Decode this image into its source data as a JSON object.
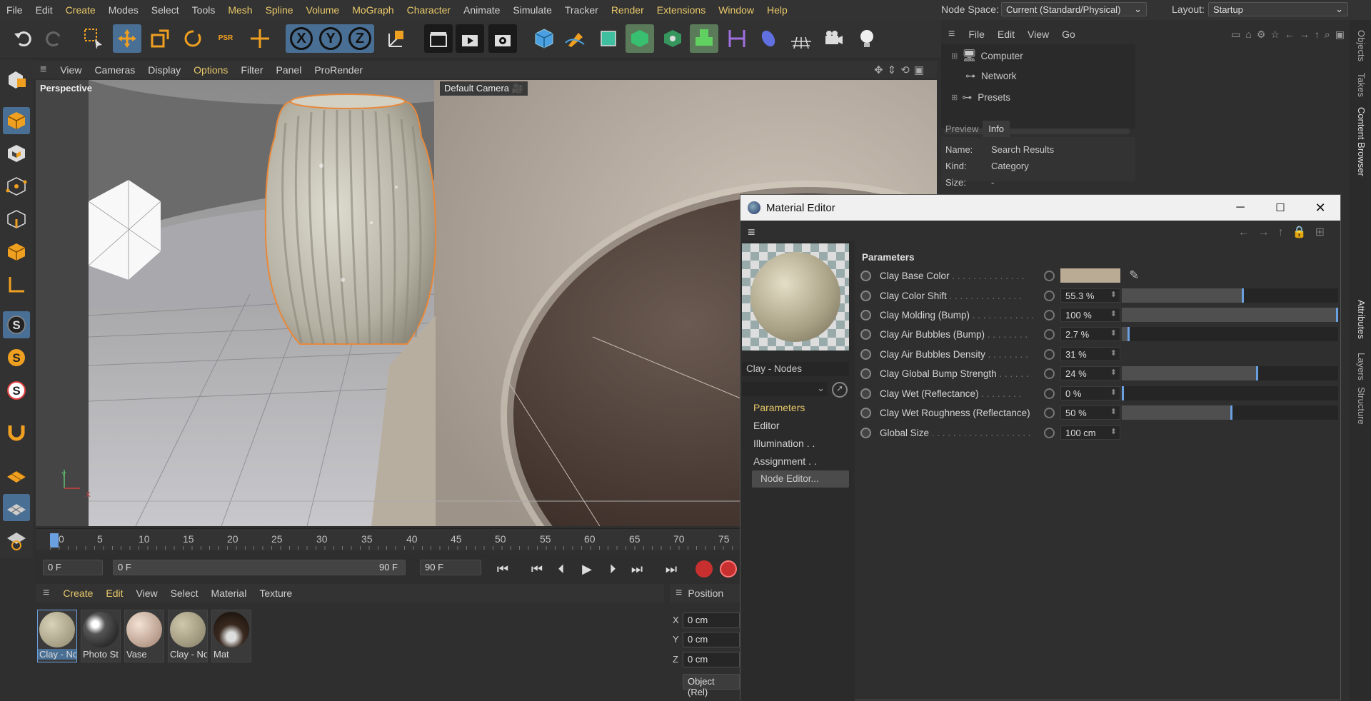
{
  "menubar": {
    "items": [
      "File",
      "Edit",
      "Create",
      "Modes",
      "Select",
      "Tools",
      "Mesh",
      "Spline",
      "Volume",
      "MoGraph",
      "Character",
      "Animate",
      "Simulate",
      "Tracker",
      "Render",
      "Extensions",
      "Window",
      "Help"
    ],
    "node_space_label": "Node Space:",
    "node_space_value": "Current (Standard/Physical)",
    "layout_label": "Layout:",
    "layout_value": "Startup"
  },
  "toolbar": {
    "axis_x": "X",
    "axis_y": "Y",
    "axis_z": "Z",
    "psr": "PSR"
  },
  "viewport": {
    "menu": [
      "View",
      "Cameras",
      "Display",
      "Options",
      "Filter",
      "Panel",
      "ProRender"
    ],
    "view_name": "Perspective",
    "camera_name": "Default Camera",
    "axis_y": "Y",
    "axis_x": "X"
  },
  "timeline": {
    "ticks": [
      "0",
      "5",
      "10",
      "15",
      "20",
      "25",
      "30",
      "35",
      "40",
      "45",
      "50",
      "55",
      "60",
      "65",
      "70",
      "75"
    ],
    "current_frame": "0 F",
    "range_start": "0 F",
    "range_end": "90 F",
    "end_frame": "90 F"
  },
  "material_manager": {
    "menu": [
      "Create",
      "Edit",
      "View",
      "Select",
      "Material",
      "Texture"
    ],
    "materials": [
      {
        "label": "Clay - No",
        "color": "#b0a98a"
      },
      {
        "label": "Photo St",
        "color": "#1a1a1a"
      },
      {
        "label": "Vase",
        "color": "#d9bfae"
      },
      {
        "label": "Clay - No",
        "color": "#a89f83"
      },
      {
        "label": "Mat",
        "color": "#2a1f18"
      }
    ]
  },
  "coordinates": {
    "title": "Position",
    "x_label": "X",
    "x_value": "0 cm",
    "y_label": "Y",
    "y_value": "0 cm",
    "z_label": "Z",
    "z_value": "0 cm",
    "mode_button": "Object (Rel)"
  },
  "content_browser": {
    "menu": [
      "File",
      "Edit",
      "View",
      "Go"
    ],
    "tree": [
      "Computer",
      "Network",
      "Presets"
    ],
    "tabs": [
      "Preview",
      "Info"
    ],
    "info": {
      "name_label": "Name:",
      "name_value": "Search Results",
      "kind_label": "Kind:",
      "kind_value": "Category",
      "size_label": "Size:",
      "size_value": "-"
    }
  },
  "side_tabs": [
    "Objects",
    "Takes",
    "Content Browser",
    "Attributes",
    "Layers",
    "Structure"
  ],
  "material_editor": {
    "title": "Material Editor",
    "material_name": "Clay - Nodes",
    "nav": [
      "Parameters",
      "Editor",
      "Illumination . .",
      "Assignment . .",
      "Node Editor..."
    ],
    "section_title": "Parameters",
    "params": [
      {
        "name": "Clay Base Color",
        "value": "",
        "fraction": null
      },
      {
        "name": "Clay Color Shift",
        "value": "55.3 %",
        "fraction": 0.553
      },
      {
        "name": "Clay Molding (Bump)",
        "value": "100 %",
        "fraction": 1.0
      },
      {
        "name": "Clay Air Bubbles (Bump)",
        "value": "2.7 %",
        "fraction": 0.027
      },
      {
        "name": "Clay Air Bubbles Density",
        "value": "31 %",
        "fraction": null
      },
      {
        "name": "Clay Global Bump Strength",
        "value": "24 %",
        "fraction": 0.62
      },
      {
        "name": "Clay Wet (Reflectance)",
        "value": "0 %",
        "fraction": 0.0
      },
      {
        "name": "Clay Wet Roughness (Reflectance)",
        "value": "50 %",
        "fraction": 0.5
      },
      {
        "name": "Global Size",
        "value": "100 cm",
        "fraction": null
      }
    ],
    "base_color": "#b9ab94"
  }
}
